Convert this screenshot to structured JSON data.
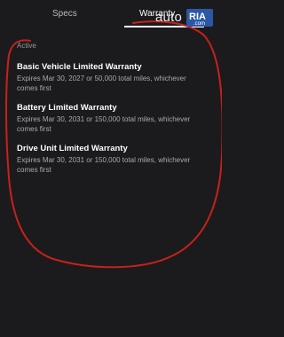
{
  "tabs": {
    "specs_label": "Specs",
    "warranty_label": "Warranty"
  },
  "watermark": {
    "auto": "auto",
    "ria": "RIA",
    "com": ".com"
  },
  "section": {
    "label": "Active"
  },
  "warranties": [
    {
      "title": "Basic Vehicle Limited Warranty",
      "description": "Expires Mar 30, 2027 or 50,000 total miles, whichever comes first"
    },
    {
      "title": "Battery Limited Warranty",
      "description": "Expires Mar 30, 2031 or 150,000 total miles, whichever comes first"
    },
    {
      "title": "Drive Unit Limited Warranty",
      "description": "Expires Mar 30, 2031 or 150,000 total miles, whichever comes first"
    }
  ],
  "colors": {
    "background": "#1b1b1d",
    "annotation": "#c8211a"
  }
}
